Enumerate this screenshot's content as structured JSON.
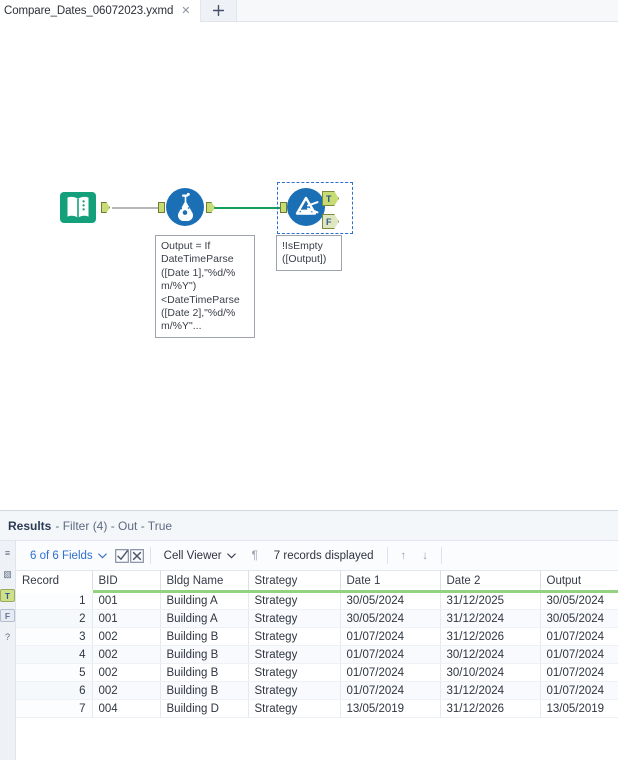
{
  "tabbar": {
    "active_tab_title": "Compare_Dates_06072023.yxmd",
    "close_glyph": "✕",
    "new_tab_label": "+"
  },
  "canvas": {
    "nodes": [
      {
        "id": "text-input",
        "name": "text-input-tool",
        "icon": "book-icon"
      },
      {
        "id": "formula",
        "name": "formula-tool",
        "icon": "flask-icon"
      },
      {
        "id": "filter",
        "name": "filter-tool",
        "icon": "funnel-icon",
        "selected": true
      }
    ],
    "filter_outputs": [
      {
        "label": "T",
        "name": "filter-true-output"
      },
      {
        "label": "F",
        "name": "filter-false-output"
      }
    ],
    "annotations": [
      {
        "name": "formula-annotation",
        "lines": [
          "Output = If",
          "DateTimeParse",
          "([Date 1],\"%d/%",
          "m/%Y\")",
          "<DateTimeParse",
          "([Date 2],\"%d/%",
          "m/%Y\"..."
        ]
      },
      {
        "name": "filter-annotation",
        "lines": [
          "!IsEmpty",
          "([Output])"
        ]
      }
    ]
  },
  "results": {
    "title_strong": "Results",
    "title_rest": "- Filter (4) - Out - True",
    "toolbar": {
      "fields_label": "6 of 6 Fields",
      "caret": "⌄",
      "select_all_icon": "checked-box-icon",
      "deselect_all_icon": "x-box-icon",
      "viewer_label": "Cell Viewer",
      "pilcrow": "¶",
      "records_label": "7 records displayed",
      "up_arrow": "↑",
      "down_arrow": "↓"
    },
    "rail": [
      {
        "name": "fields-list-icon",
        "glyph": "≡",
        "type": "icon"
      },
      {
        "name": "panel-layout-icon",
        "glyph": "▧",
        "type": "icon"
      },
      {
        "name": "rail-output-true",
        "glyph": "T",
        "type": "tf",
        "active": true
      },
      {
        "name": "rail-output-false",
        "glyph": "F",
        "type": "tf",
        "active": false
      },
      {
        "name": "help-icon",
        "glyph": "?",
        "type": "icon"
      }
    ],
    "table": {
      "columns": [
        "Record",
        "BID",
        "Bldg Name",
        "Strategy",
        "Date 1",
        "Date 2",
        "Output"
      ],
      "rows": [
        [
          "1",
          "001",
          "Building A",
          "Strategy",
          "30/05/2024",
          "31/12/2025",
          "30/05/2024"
        ],
        [
          "2",
          "001",
          "Building A",
          "Strategy",
          "30/05/2024",
          "31/12/2024",
          "30/05/2024"
        ],
        [
          "3",
          "002",
          "Building B",
          "Strategy",
          "01/07/2024",
          "31/12/2026",
          "01/07/2024"
        ],
        [
          "4",
          "002",
          "Building B",
          "Strategy",
          "01/07/2024",
          "30/12/2024",
          "01/07/2024"
        ],
        [
          "5",
          "002",
          "Building B",
          "Strategy",
          "01/07/2024",
          "30/10/2024",
          "01/07/2024"
        ],
        [
          "6",
          "002",
          "Building B",
          "Strategy",
          "01/07/2024",
          "31/12/2024",
          "01/07/2024"
        ],
        [
          "7",
          "004",
          "Building D",
          "Strategy",
          "13/05/2019",
          "31/12/2026",
          "13/05/2019"
        ]
      ]
    }
  },
  "colors": {
    "text_input_green": "#13A07A",
    "tool_blue": "#1B6FB5",
    "connection_green": "#13A05C",
    "connection_grey": "#B4B6B8",
    "anchor_green": "#C8DC76",
    "header_underline": "#93D37F",
    "link_blue": "#2F6FD0"
  }
}
